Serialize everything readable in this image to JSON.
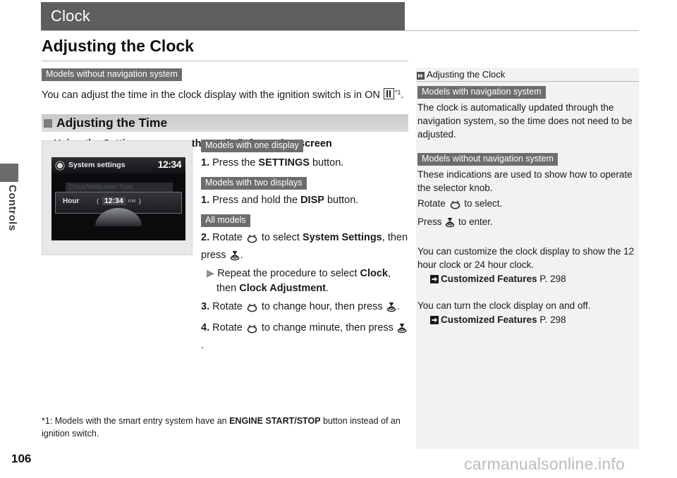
{
  "header": {
    "title": "Clock"
  },
  "chapter": {
    "label": "Controls"
  },
  "page": {
    "number": "106",
    "watermark": "carmanualsonline.info"
  },
  "main": {
    "section_title": "Adjusting the Clock",
    "tag_without_nav": "Models without navigation system",
    "intro_before_icon": "You can adjust the time in the clock display with the ignition switch is in ON ",
    "intro_icon": "ignition-on-icon",
    "intro_footnote_marker": "*1",
    "intro_after_icon": ".",
    "band_heading": "Adjusting the Time",
    "subheading": "Using the Settings menu on the audio/information screen"
  },
  "figure": {
    "screen_title": "System settings",
    "screen_clock": "12:34",
    "ghost_row": "Clock/Wallpaper Type",
    "hour_label": "Hour",
    "time_paren_open": "(",
    "time_value": "12:34",
    "time_ampm": "AM",
    "time_paren_close": ")"
  },
  "steps": {
    "tag_one_display": "Models with one display",
    "step1a_num": "1.",
    "step1a_pre": "Press the ",
    "step1a_bold": "SETTINGS",
    "step1a_post": " button.",
    "tag_two_displays": "Models with two displays",
    "step1b_num": "1.",
    "step1b_pre": "Press and hold the ",
    "step1b_bold": "DISP",
    "step1b_post": " button.",
    "tag_all_models": "All models",
    "step2_num": "2.",
    "step2_pre": "Rotate ",
    "step2_mid": " to select ",
    "step2_bold": "System Settings",
    "step2_post": ", then press ",
    "step2_end": ".",
    "substep_pre": "Repeat the procedure to select ",
    "substep_bold1": "Clock",
    "substep_mid": ", then ",
    "substep_bold2": "Clock Adjustment",
    "substep_post": ".",
    "step3_num": "3.",
    "step3_pre": "Rotate ",
    "step3_mid": " to change hour, then press ",
    "step3_post": ".",
    "step4_num": "4.",
    "step4_pre": "Rotate ",
    "step4_mid": " to change minute, then press ",
    "step4_post": "."
  },
  "footnote": {
    "pre": "*1: Models with the smart entry system have an ",
    "bold": "ENGINE START/STOP",
    "post": " button instead of an ignition switch."
  },
  "side": {
    "head_title": "Adjusting the Clock",
    "tag_with_nav": "Models with navigation system",
    "para_with_nav": "The clock is automatically updated through the navigation system, so the time does not need to be adjusted.",
    "tag_without_nav": "Models without navigation system",
    "para_without_nav": "These indications are used to show how to operate the selector knob.",
    "rotate_pre": "Rotate ",
    "rotate_post": " to select.",
    "press_pre": "Press ",
    "press_post": " to enter.",
    "customize_text": "You can customize the clock display to show the 12 hour clock or 24 hour clock.",
    "xref1_label": "Customized Features",
    "xref1_page": "P. 298",
    "onoff_text": "You can turn the clock display on and off.",
    "xref2_label": "Customized Features",
    "xref2_page": "P. 298"
  },
  "colors": {
    "header_bar": "#5e5e5e",
    "tag_bg": "#6d6d6d",
    "band_gray": "#c9c9c9",
    "side_panel_bg": "#f2f2f2",
    "watermark": "#bdbdbd"
  }
}
